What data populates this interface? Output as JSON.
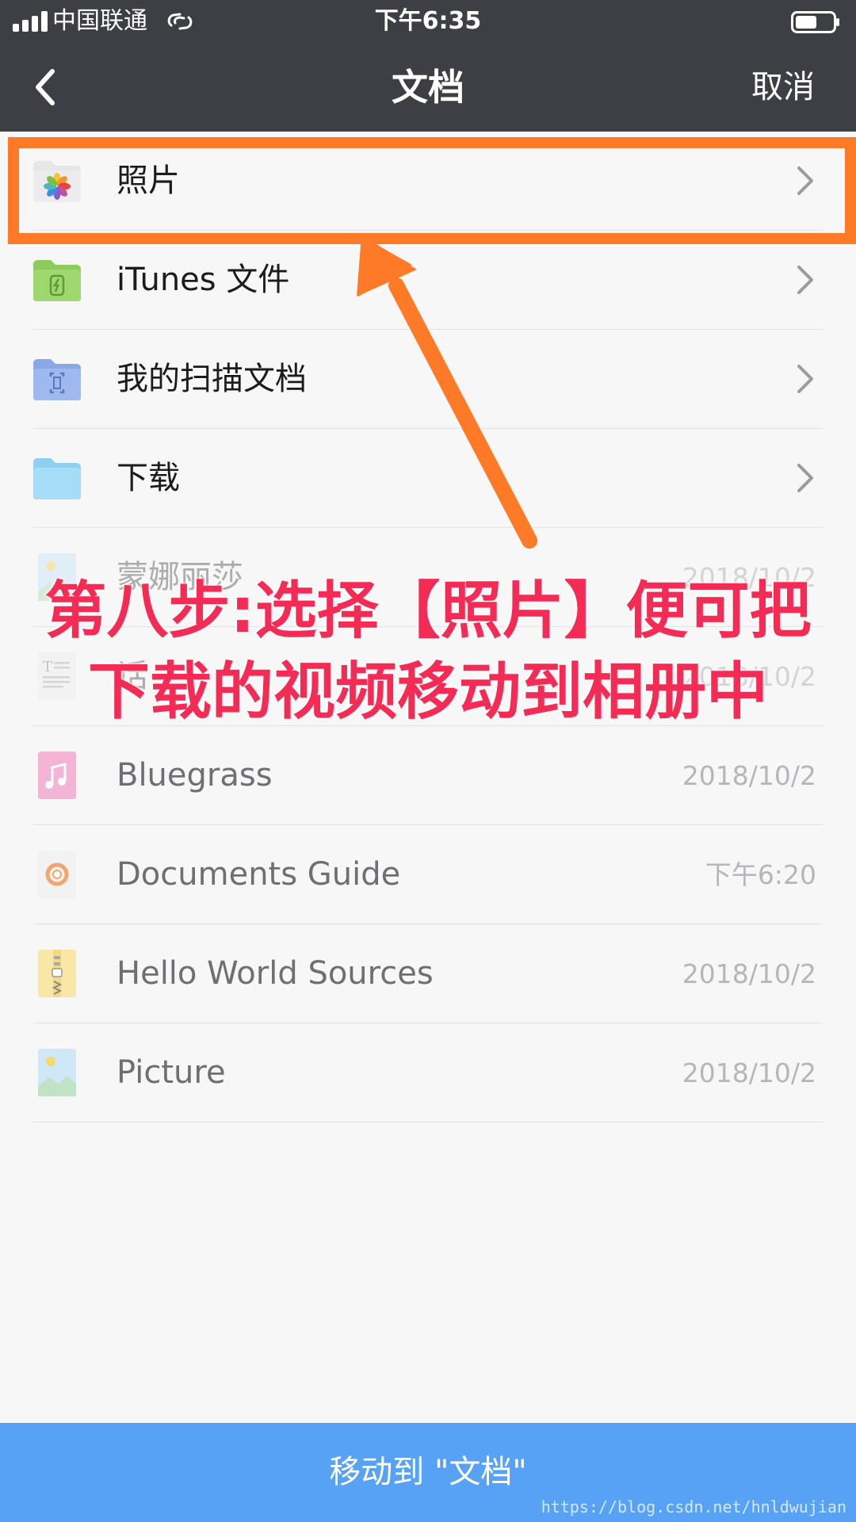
{
  "status_bar": {
    "carrier": "中国联通",
    "time": "下午6:35"
  },
  "nav": {
    "title": "文档",
    "cancel_label": "取消"
  },
  "folders": [
    {
      "name": "照片",
      "icon": "photos-folder-icon"
    },
    {
      "name": "iTunes 文件",
      "icon": "itunes-folder-icon"
    },
    {
      "name": "我的扫描文档",
      "icon": "scan-folder-icon"
    },
    {
      "name": "下载",
      "icon": "download-folder-icon"
    }
  ],
  "files": [
    {
      "name": "蒙娜丽莎",
      "date": "2018/10/2",
      "icon": "image-file-icon"
    },
    {
      "name": "话",
      "date": "2018/10/2",
      "icon": "text-file-icon"
    },
    {
      "name": "Bluegrass",
      "date": "2018/10/2",
      "icon": "music-file-icon"
    },
    {
      "name": "Documents Guide",
      "date": "下午6:20",
      "icon": "guide-file-icon"
    },
    {
      "name": "Hello World Sources",
      "date": "2018/10/2",
      "icon": "zip-file-icon"
    },
    {
      "name": "Picture",
      "date": "2018/10/2",
      "icon": "image-file-icon"
    }
  ],
  "annotation": {
    "line1": "第八步:选择【照片】便可把",
    "line2": "下载的视频移动到相册中"
  },
  "bottom": {
    "move_label": "移动到 \"文档\""
  },
  "watermark": "https://blog.csdn.net/hnldwujian",
  "colors": {
    "header_bg": "#3e3f44",
    "highlight": "#ff7a26",
    "annotation_text": "#f42c55",
    "button_bg": "#57a2f4"
  }
}
